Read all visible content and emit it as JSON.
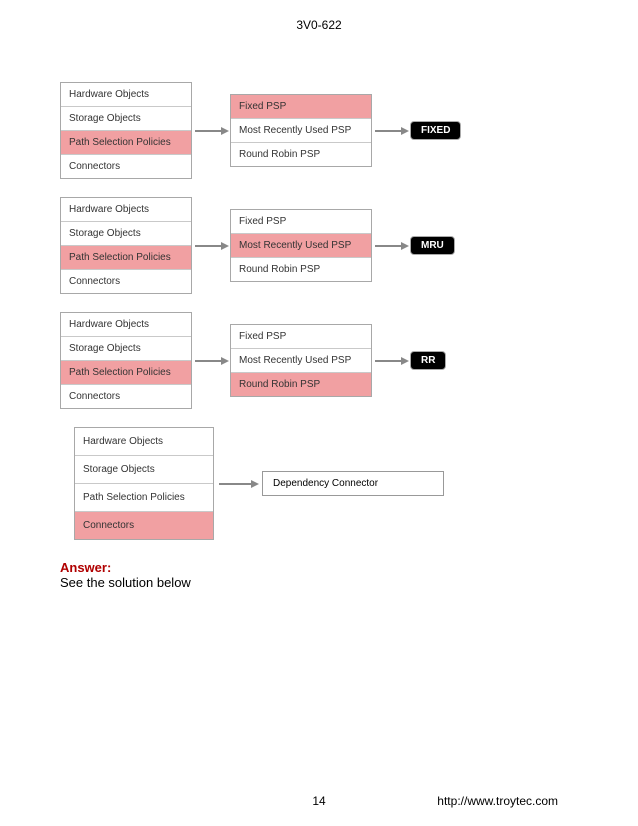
{
  "header": {
    "title": "3V0-622"
  },
  "left_items": [
    "Hardware Objects",
    "Storage Objects",
    "Path Selection Policies",
    "Connectors"
  ],
  "psp_items": [
    "Fixed PSP",
    "Most Recently Used PSP",
    "Round Robin PSP"
  ],
  "rows": [
    {
      "left_highlight_index": 2,
      "mid_highlight_index": 0,
      "pill": "FIXED"
    },
    {
      "left_highlight_index": 2,
      "mid_highlight_index": 1,
      "pill": "MRU"
    },
    {
      "left_highlight_index": 2,
      "mid_highlight_index": 2,
      "pill": "RR"
    }
  ],
  "row4": {
    "left_highlight_index": 3,
    "result_label": "Dependency Connector"
  },
  "answer": {
    "label": "Answer:",
    "text": "See the solution below"
  },
  "footer": {
    "page": "14",
    "url": "http://www.troytec.com"
  }
}
